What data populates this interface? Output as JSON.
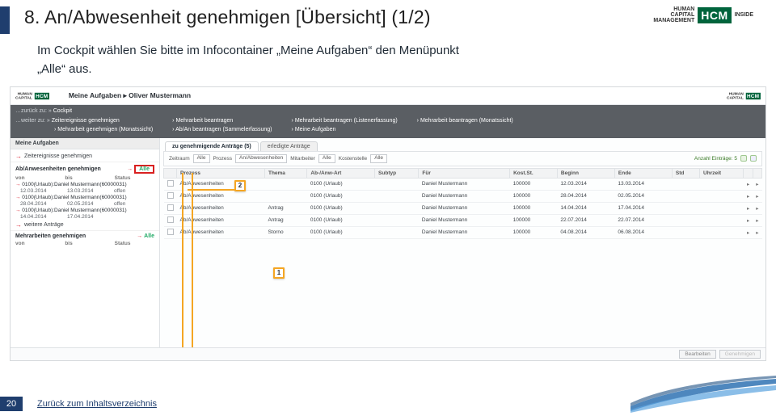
{
  "slide": {
    "title": "8. An/Abwesenheit genehmigen [Übersicht] (1/2)",
    "body_line1": "Im Cockpit wählen Sie bitte im Infocontainer „Meine Aufgaben“ den Menüpunkt",
    "body_line2": "„Alle“ aus.",
    "page_number": "20",
    "back_link": "Zurück zum Inhaltsverzeichnis"
  },
  "logo": {
    "line1": "HUMAN",
    "line2": "CAPITAL",
    "line3": "MANAGEMENT",
    "line4": "INSIDE",
    "box": "HCM"
  },
  "app": {
    "breadcrumb": "Meine Aufgaben ▸ Oliver Mustermann",
    "nav": {
      "zurueck_label": "…zurück zu: »",
      "weiter_label": "…weiter zu: »",
      "col1a": "Cockpit",
      "col1b": "Zeitereignisse genehmigen",
      "col1c": "Mehrarbeit genehmigen (Monatssicht)",
      "col2a": "Mehrarbeit beantragen",
      "col2b": "Ab/An beantragen (Sammelerfassung)",
      "col3a": "Mehrarbeit beantragen (Listenerfassung)",
      "col3b": "Meine Aufgaben",
      "col4a": "Mehrarbeit beantragen (Monatssicht)"
    },
    "sidebar": {
      "title": "Meine Aufgaben",
      "link_zeitereignisse": "Zeitereignisse genehmigen",
      "section_ab": "Ab/Anwesenheiten genehmigen",
      "alle_label": "Alle",
      "col_von": "von",
      "col_bis": "bis",
      "col_status": "Status",
      "rows": [
        {
          "title": "0100(Urlaub):Daniel Mustermann(60000031)",
          "von": "12.03.2014",
          "bis": "13.03.2014",
          "status": "offen"
        },
        {
          "title": "0100(Urlaub):Daniel Mustermann(60000031)",
          "von": "28.04.2014",
          "bis": "02.05.2014",
          "status": "offen"
        },
        {
          "title": "0100(Urlaub):Daniel Mustermann(60000031)",
          "von": "14.04.2014",
          "bis": "17.04.2014",
          "status": ""
        }
      ],
      "link_weitere": "weitere Anträge",
      "section_mehr": "Mehrarbeiten genehmigen",
      "mehr_alle": "Alle"
    },
    "tabs": {
      "active": "zu genehmigende Anträge (5)",
      "other": "erledigte Anträge"
    },
    "filters": {
      "zeitraum_label": "Zeitraum",
      "zeitraum_value": "Alle",
      "prozess_label": "Prozess",
      "prozess_value": "An/Abwesenheiten",
      "mitarbeiter_label": "Mitarbeiter",
      "mitarbeiter_value": "Alle",
      "kostenstelle_label": "Kostenstelle",
      "kostenstelle_value": "Alle",
      "count_label": "Anzahl Einträge: 5"
    },
    "columns": [
      "",
      "Prozess",
      "Thema",
      "Ab-/Anw-Art",
      "Subtyp",
      "Für",
      "Kost.St.",
      "Beginn",
      "Ende",
      "Std",
      "Uhrzeit",
      "",
      ""
    ],
    "rows": [
      {
        "prozess": "Ab/Anwesenheiten",
        "thema": "",
        "art": "0100 (Urlaub)",
        "subtyp": "",
        "fuer": "Daniel Mustermann",
        "kst": "100000",
        "beginn": "12.03.2014",
        "ende": "13.03.2014",
        "std": "",
        "uhr": ""
      },
      {
        "prozess": "Ab/Anwesenheiten",
        "thema": "",
        "art": "0100 (Urlaub)",
        "subtyp": "",
        "fuer": "Daniel Mustermann",
        "kst": "100000",
        "beginn": "28.04.2014",
        "ende": "02.05.2014",
        "std": "",
        "uhr": ""
      },
      {
        "prozess": "Ab/Anwesenheiten",
        "thema": "Antrag",
        "art": "0100 (Urlaub)",
        "subtyp": "",
        "fuer": "Daniel Mustermann",
        "kst": "100000",
        "beginn": "14.04.2014",
        "ende": "17.04.2014",
        "std": "",
        "uhr": ""
      },
      {
        "prozess": "Ab/Anwesenheiten",
        "thema": "Antrag",
        "art": "0100 (Urlaub)",
        "subtyp": "",
        "fuer": "Daniel Mustermann",
        "kst": "100000",
        "beginn": "22.07.2014",
        "ende": "22.07.2014",
        "std": "",
        "uhr": ""
      },
      {
        "prozess": "Ab/Anwesenheiten",
        "thema": "Storno",
        "art": "0100 (Urlaub)",
        "subtyp": "",
        "fuer": "Daniel Mustermann",
        "kst": "100000",
        "beginn": "04.08.2014",
        "ende": "06.08.2014",
        "std": "",
        "uhr": ""
      }
    ],
    "footer": {
      "bearbeiten": "Bearbeiten",
      "genehmigen": "Genehmigen"
    }
  },
  "annotations": {
    "one": "1",
    "two": "2"
  }
}
